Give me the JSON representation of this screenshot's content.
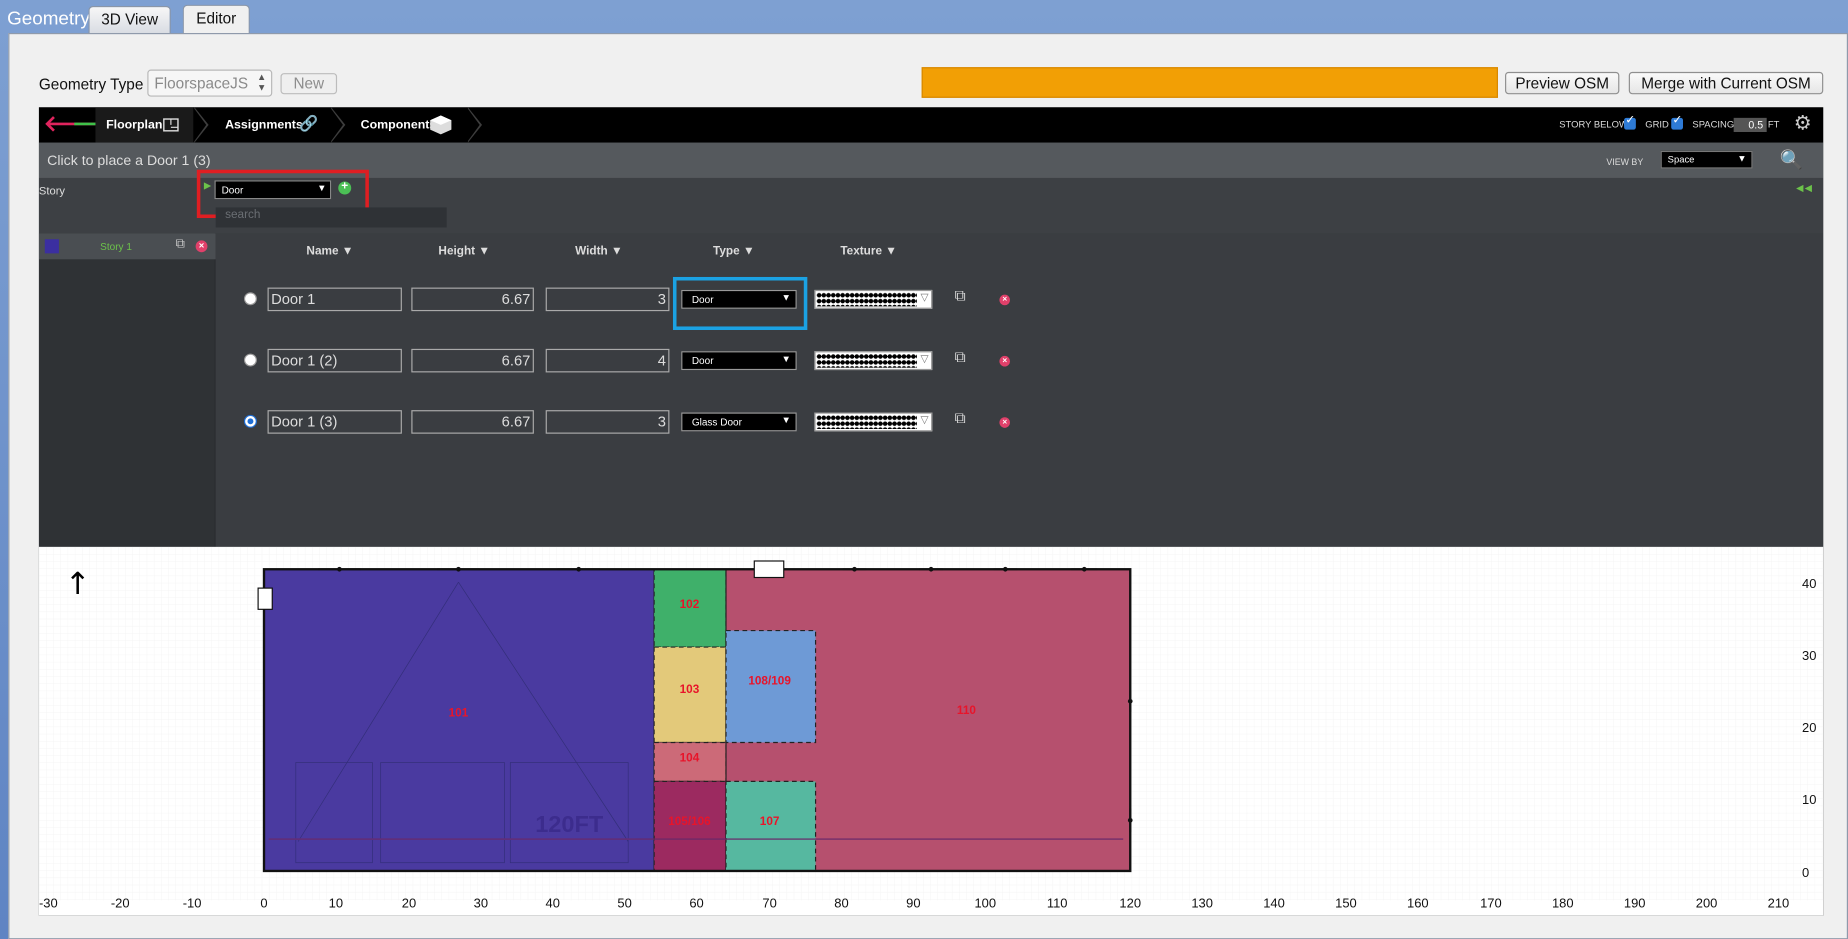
{
  "window": {
    "title": "Geometry",
    "tabs": [
      {
        "label": "3D View"
      },
      {
        "label": "Editor"
      }
    ]
  },
  "geometry_type": {
    "label": "Geometry Type",
    "value": "FloorspaceJS",
    "new_label": "New"
  },
  "toolbar": {
    "preview_label": "Preview OSM",
    "merge_label": "Merge with Current OSM",
    "progress_color": "#f29f05"
  },
  "nav": {
    "tabs": [
      {
        "label": "Floorplan",
        "active": true
      },
      {
        "label": "Assignments"
      },
      {
        "label": "Components"
      }
    ],
    "story_below_label": "STORY BELOW",
    "story_below_checked": true,
    "grid_label": "GRID",
    "grid_checked": true,
    "spacing_label": "SPACING",
    "spacing_value": "0.5",
    "spacing_unit": "FT"
  },
  "instruction": "Click to place a Door 1 (3)",
  "view_by": {
    "label": "VIEW BY",
    "value": "Space"
  },
  "story_panel": {
    "label": "Story",
    "component_select": "Door",
    "search_placeholder": "search"
  },
  "stories": [
    {
      "name": "Story 1",
      "color": "#3b2fa0"
    }
  ],
  "table": {
    "headers": {
      "name": "Name ▼",
      "height": "Height ▼",
      "width": "Width ▼",
      "type": "Type ▼",
      "texture": "Texture ▼"
    },
    "rows": [
      {
        "name": "Door 1",
        "height": "6.67",
        "width": "3",
        "type": "Door",
        "selected": false
      },
      {
        "name": "Door 1 (2)",
        "height": "6.67",
        "width": "4",
        "type": "Door",
        "selected": false
      },
      {
        "name": "Door 1 (3)",
        "height": "6.67",
        "width": "3",
        "type": "Glass Door",
        "selected": true
      }
    ]
  },
  "floorplan": {
    "x_ticks": [
      "-30",
      "-20",
      "-10",
      "0",
      "10",
      "20",
      "30",
      "40",
      "50",
      "60",
      "70",
      "80",
      "90",
      "100",
      "110",
      "120",
      "130",
      "140",
      "150",
      "160",
      "170",
      "180",
      "190",
      "200",
      "210"
    ],
    "y_ticks": [
      "40",
      "30",
      "20",
      "10",
      "0"
    ],
    "scale_label": "120FT",
    "spaces": [
      {
        "name": "101",
        "color": "#4a3aa0"
      },
      {
        "name": "102",
        "color": "#3fb06a"
      },
      {
        "name": "103",
        "color": "#e3c97a"
      },
      {
        "name": "104",
        "color": "#cc6a78"
      },
      {
        "name": "105/106",
        "color": "#9c2a60"
      },
      {
        "name": "107",
        "color": "#56b8a0"
      },
      {
        "name": "108/109",
        "color": "#6e9ad6"
      },
      {
        "name": "110",
        "color": "#b6506e"
      }
    ]
  }
}
